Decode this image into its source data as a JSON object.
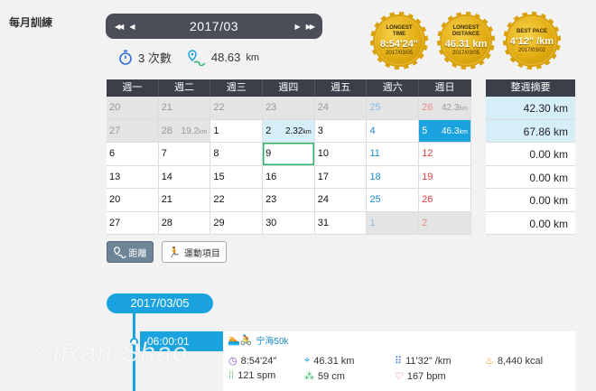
{
  "page_title": "每月訓練",
  "month_nav": {
    "prev_year": "◀◀",
    "prev": "◀",
    "label": "2017/03",
    "next": "▶",
    "next_year": "▶▶"
  },
  "stats": {
    "count": "3 次數",
    "distance": "48.63",
    "distance_unit": "km"
  },
  "medals": [
    {
      "title": "LONGEST TIME",
      "value": "8:54'24\"",
      "date": "2017/03/05"
    },
    {
      "title": "LONGEST DISTANCE",
      "value": "46.31 km",
      "date": "2017/03/05"
    },
    {
      "title": "BEST PACE",
      "value": "4'12\" /km",
      "date": "2017/03/02"
    }
  ],
  "weekdays": [
    "週一",
    "週二",
    "週三",
    "週四",
    "週五",
    "週六",
    "週日"
  ],
  "weeks": [
    [
      {
        "d": "20",
        "s": "dim"
      },
      {
        "d": "21",
        "s": "dim"
      },
      {
        "d": "22",
        "s": "dim"
      },
      {
        "d": "23",
        "s": "dim"
      },
      {
        "d": "24",
        "s": "dim"
      },
      {
        "d": "25",
        "s": "dim blue"
      },
      {
        "d": "26",
        "s": "dim red",
        "km": "42.3"
      }
    ],
    [
      {
        "d": "27",
        "s": "dim"
      },
      {
        "d": "28",
        "s": "dim",
        "km": "19.2"
      },
      {
        "d": "1",
        "s": ""
      },
      {
        "d": "2",
        "s": "hl",
        "km": "2.32"
      },
      {
        "d": "3",
        "s": ""
      },
      {
        "d": "4",
        "s": "blue"
      },
      {
        "d": "5",
        "s": "sel",
        "km": "46.3"
      }
    ],
    [
      {
        "d": "6",
        "s": ""
      },
      {
        "d": "7",
        "s": ""
      },
      {
        "d": "8",
        "s": ""
      },
      {
        "d": "9",
        "s": "today"
      },
      {
        "d": "10",
        "s": ""
      },
      {
        "d": "11",
        "s": "blue"
      },
      {
        "d": "12",
        "s": "red"
      }
    ],
    [
      {
        "d": "13",
        "s": ""
      },
      {
        "d": "14",
        "s": ""
      },
      {
        "d": "15",
        "s": ""
      },
      {
        "d": "16",
        "s": ""
      },
      {
        "d": "17",
        "s": ""
      },
      {
        "d": "18",
        "s": "blue"
      },
      {
        "d": "19",
        "s": "red"
      }
    ],
    [
      {
        "d": "20",
        "s": ""
      },
      {
        "d": "21",
        "s": ""
      },
      {
        "d": "22",
        "s": ""
      },
      {
        "d": "23",
        "s": ""
      },
      {
        "d": "24",
        "s": ""
      },
      {
        "d": "25",
        "s": "blue"
      },
      {
        "d": "26",
        "s": "red"
      }
    ],
    [
      {
        "d": "27",
        "s": ""
      },
      {
        "d": "28",
        "s": ""
      },
      {
        "d": "29",
        "s": ""
      },
      {
        "d": "30",
        "s": ""
      },
      {
        "d": "31",
        "s": ""
      },
      {
        "d": "1",
        "s": "dim blue"
      },
      {
        "d": "2",
        "s": "dim red"
      }
    ]
  ],
  "dist_unit_small": "km",
  "weekly_summary": {
    "title": "整週摘要",
    "rows": [
      {
        "value": "42.30 km",
        "hl": true
      },
      {
        "value": "67.86 km",
        "hl": true
      },
      {
        "value": "0.00 km",
        "hl": false
      },
      {
        "value": "0.00 km",
        "hl": false
      },
      {
        "value": "0.00 km",
        "hl": false
      },
      {
        "value": "0.00 km",
        "hl": false
      }
    ]
  },
  "filters": {
    "distance": "距離",
    "sport": "運動項目"
  },
  "timeline": {
    "date": "2017/03/05",
    "time": "06:00:01",
    "activity": "宁海50k",
    "metrics": {
      "duration": "8:54'24\"",
      "distance": "46.31 km",
      "pace": "11'32\" /km",
      "calories": "8,440 kcal",
      "cadence": "121 spm",
      "stride": "59 cm",
      "heart_rate": "167 bpm"
    }
  },
  "watermark": "iRan Shao",
  "colors": {
    "accent": "#1aa3de",
    "header": "#3c3f4a",
    "highlight": "#d6eef8",
    "weekend_blue": "#1a8ad1",
    "weekend_red": "#e23b3b",
    "medal_gold": "#e2ac13"
  }
}
